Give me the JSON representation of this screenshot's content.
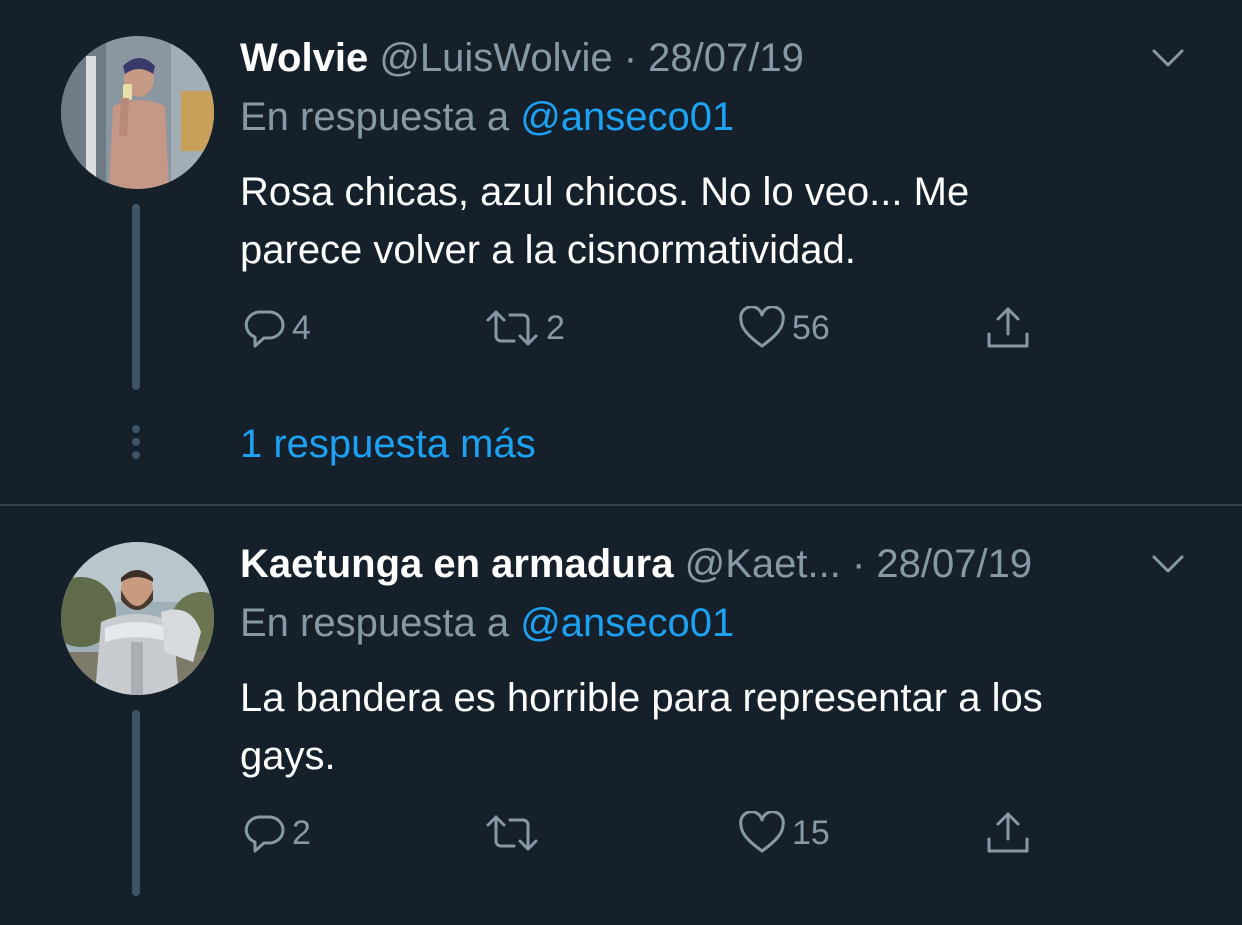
{
  "tweets": [
    {
      "display_name": "Wolvie",
      "handle": "@LuisWolvie",
      "separator": "·",
      "date": "28/07/19",
      "reply_prefix": "En respuesta a",
      "reply_mention": "@anseco01",
      "text_line1": "Rosa chicas, azul chicos. No lo veo... Me",
      "text_line2": "parece volver a la cisnormatividad.",
      "replies": "4",
      "retweets": "2",
      "likes": "56",
      "avatar_icon": "avatar-photo"
    },
    {
      "display_name": "Kaetunga en armadura",
      "handle": "@Kaet...",
      "separator": "·",
      "date": "28/07/19",
      "reply_prefix": "En respuesta a",
      "reply_mention": "@anseco01",
      "text_line1": "La bandera es horrible para representar a los",
      "text_line2": "gays.",
      "replies": "2",
      "retweets": "",
      "likes": "15",
      "avatar_icon": "avatar-photo"
    }
  ],
  "thread": {
    "show_more_label": "1 respuesta más"
  },
  "icons": {
    "reply": "reply-icon",
    "retweet": "retweet-icon",
    "like": "heart-icon",
    "share": "share-icon",
    "menu": "chevron-down-icon"
  },
  "colors": {
    "background": "#15202b",
    "accent": "#1da1f2",
    "secondary_text": "#8899a6",
    "thread_line": "#3d5466",
    "divider": "#38444d"
  }
}
